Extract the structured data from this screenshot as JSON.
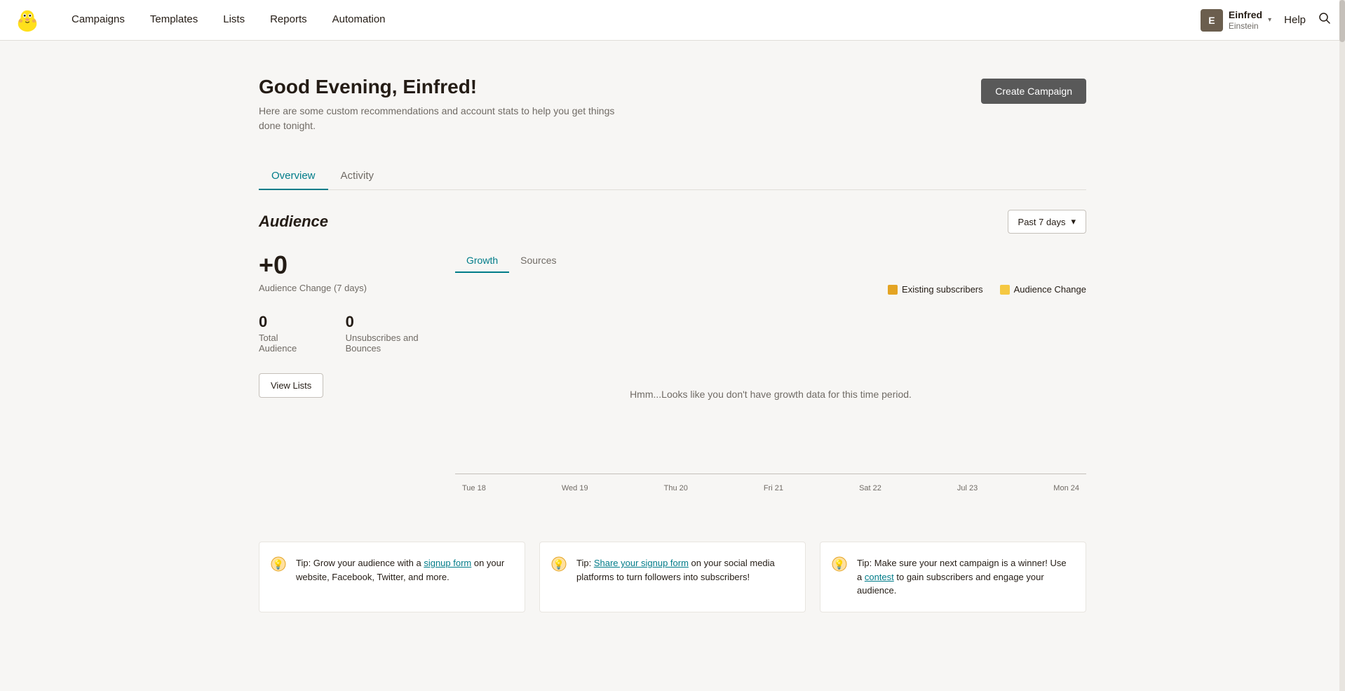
{
  "nav": {
    "logo_alt": "Mailchimp",
    "links": [
      {
        "label": "Campaigns",
        "name": "campaigns"
      },
      {
        "label": "Templates",
        "name": "templates"
      },
      {
        "label": "Lists",
        "name": "lists"
      },
      {
        "label": "Reports",
        "name": "reports"
      },
      {
        "label": "Automation",
        "name": "automation"
      }
    ],
    "user": {
      "initials": "E",
      "name": "Einfred",
      "sub": "Einstein"
    },
    "help": "Help"
  },
  "header": {
    "title": "Good Evening, Einfred!",
    "subtitle": "Here are some custom recommendations and account stats to help you get things done tonight.",
    "create_btn": "Create Campaign"
  },
  "tabs": [
    {
      "label": "Overview",
      "active": true
    },
    {
      "label": "Activity",
      "active": false
    }
  ],
  "audience": {
    "section_title": "Audience",
    "period_btn": "Past 7 days",
    "change_value": "+0",
    "change_label": "Audience Change (7 days)",
    "total_audience_value": "0",
    "total_audience_label": "Total Audience",
    "unsub_value": "0",
    "unsub_label": "Unsubscribes and Bounces",
    "view_lists_btn": "View Lists",
    "chart_tabs": [
      {
        "label": "Growth",
        "active": true
      },
      {
        "label": "Sources",
        "active": false
      }
    ],
    "legend": [
      {
        "label": "Existing subscribers",
        "color": "#e4a423"
      },
      {
        "label": "Audience Change",
        "color": "#f5c842"
      }
    ],
    "chart_empty_msg": "Hmm...Looks like you don't have growth data for this time period.",
    "x_labels": [
      "Tue 18",
      "Wed 19",
      "Thu 20",
      "Fri 21",
      "Sat 22",
      "Jul 23",
      "Mon 24"
    ]
  },
  "tips": [
    {
      "text_before": "Tip: Grow your audience with a ",
      "link_text": "signup form",
      "text_after": " on your website, Facebook, Twitter, and more."
    },
    {
      "text_before": "Tip: ",
      "link_text": "Share your signup form",
      "text_after": " on your social media platforms to turn followers into subscribers!"
    },
    {
      "text_before": "Tip: Make sure your next campaign is a winner! Use a ",
      "link_text": "contest",
      "text_after": " to gain subscribers and engage your audience."
    }
  ]
}
